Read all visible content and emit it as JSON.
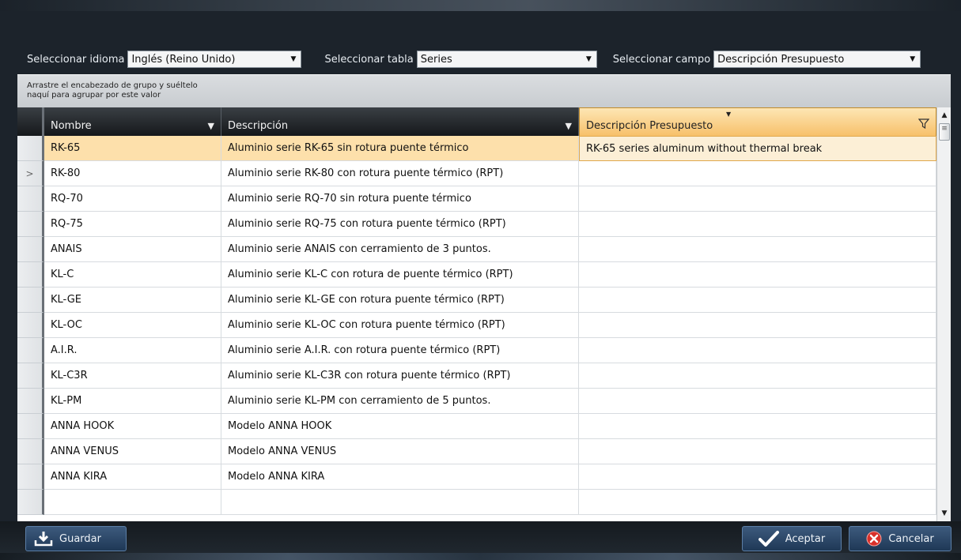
{
  "toolbar": {
    "language_label": "Seleccionar idioma",
    "language_value": "Inglés (Reino Unido)",
    "table_label": "Seleccionar tabla",
    "table_value": "Series",
    "field_label": "Seleccionar campo",
    "field_value": "Descripción Presupuesto"
  },
  "group_panel": {
    "hint_line1": "Arrastre el encabezado de grupo y suéltelo",
    "hint_line2": "naquí para agrupar por este valor"
  },
  "grid": {
    "columns": [
      {
        "label": "Nombre"
      },
      {
        "label": "Descripción"
      },
      {
        "label": "Descripción Presupuesto"
      }
    ],
    "rows": [
      {
        "name": "RK-65",
        "description": "Aluminio serie RK-65 sin rotura puente térmico",
        "budget": "RK-65 series aluminum without thermal break",
        "indicator": ""
      },
      {
        "name": "RK-80",
        "description": "Aluminio serie RK-80 con rotura puente térmico (RPT)",
        "budget": "",
        "indicator": ">"
      },
      {
        "name": "RQ-70",
        "description": "Aluminio serie RQ-70 sin rotura puente térmico",
        "budget": "",
        "indicator": ""
      },
      {
        "name": "RQ-75",
        "description": "Aluminio serie RQ-75 con rotura puente térmico (RPT)",
        "budget": "",
        "indicator": ""
      },
      {
        "name": "ANAIS",
        "description": "Aluminio serie ANAIS con cerramiento de 3 puntos.",
        "budget": "",
        "indicator": ""
      },
      {
        "name": "KL-C",
        "description": "Aluminio serie KL-C con rotura de puente térmico (RPT)",
        "budget": "",
        "indicator": ""
      },
      {
        "name": "KL-GE",
        "description": "Aluminio serie KL-GE con rotura puente térmico (RPT)",
        "budget": "",
        "indicator": ""
      },
      {
        "name": "KL-OC",
        "description": "Aluminio serie KL-OC con rotura puente térmico (RPT)",
        "budget": "",
        "indicator": ""
      },
      {
        "name": "A.I.R.",
        "description": "Aluminio serie A.I.R. con rotura puente térmico (RPT)",
        "budget": "",
        "indicator": ""
      },
      {
        "name": "KL-C3R",
        "description": "Aluminio serie KL-C3R con rotura puente térmico (RPT)",
        "budget": "",
        "indicator": ""
      },
      {
        "name": "KL-PM",
        "description": "Aluminio serie KL-PM con cerramiento de 5 puntos.",
        "budget": "",
        "indicator": ""
      },
      {
        "name": "ANNA HOOK",
        "description": "Modelo ANNA HOOK",
        "budget": "",
        "indicator": ""
      },
      {
        "name": "ANNA VENUS",
        "description": "Modelo ANNA VENUS",
        "budget": "",
        "indicator": ""
      },
      {
        "name": "ANNA KIRA",
        "description": "Modelo ANNA KIRA",
        "budget": "",
        "indicator": ""
      },
      {
        "name": "",
        "description": "",
        "budget": "",
        "indicator": ""
      }
    ]
  },
  "footer": {
    "save_label": "Guardar",
    "accept_label": "Aceptar",
    "cancel_label": "Cancelar"
  },
  "colors": {
    "accent_header": "#f7c06a",
    "selected_row": "#fde0ab",
    "button_blue": "#2b4a70",
    "cancel_red": "#d9302a",
    "accept_check": "#ffffff"
  },
  "icons": {
    "save": "download-icon",
    "accept": "checkmark-icon",
    "cancel": "close-circle-icon",
    "filter": "filter-icon",
    "dropdown": "chevron-down-icon"
  }
}
